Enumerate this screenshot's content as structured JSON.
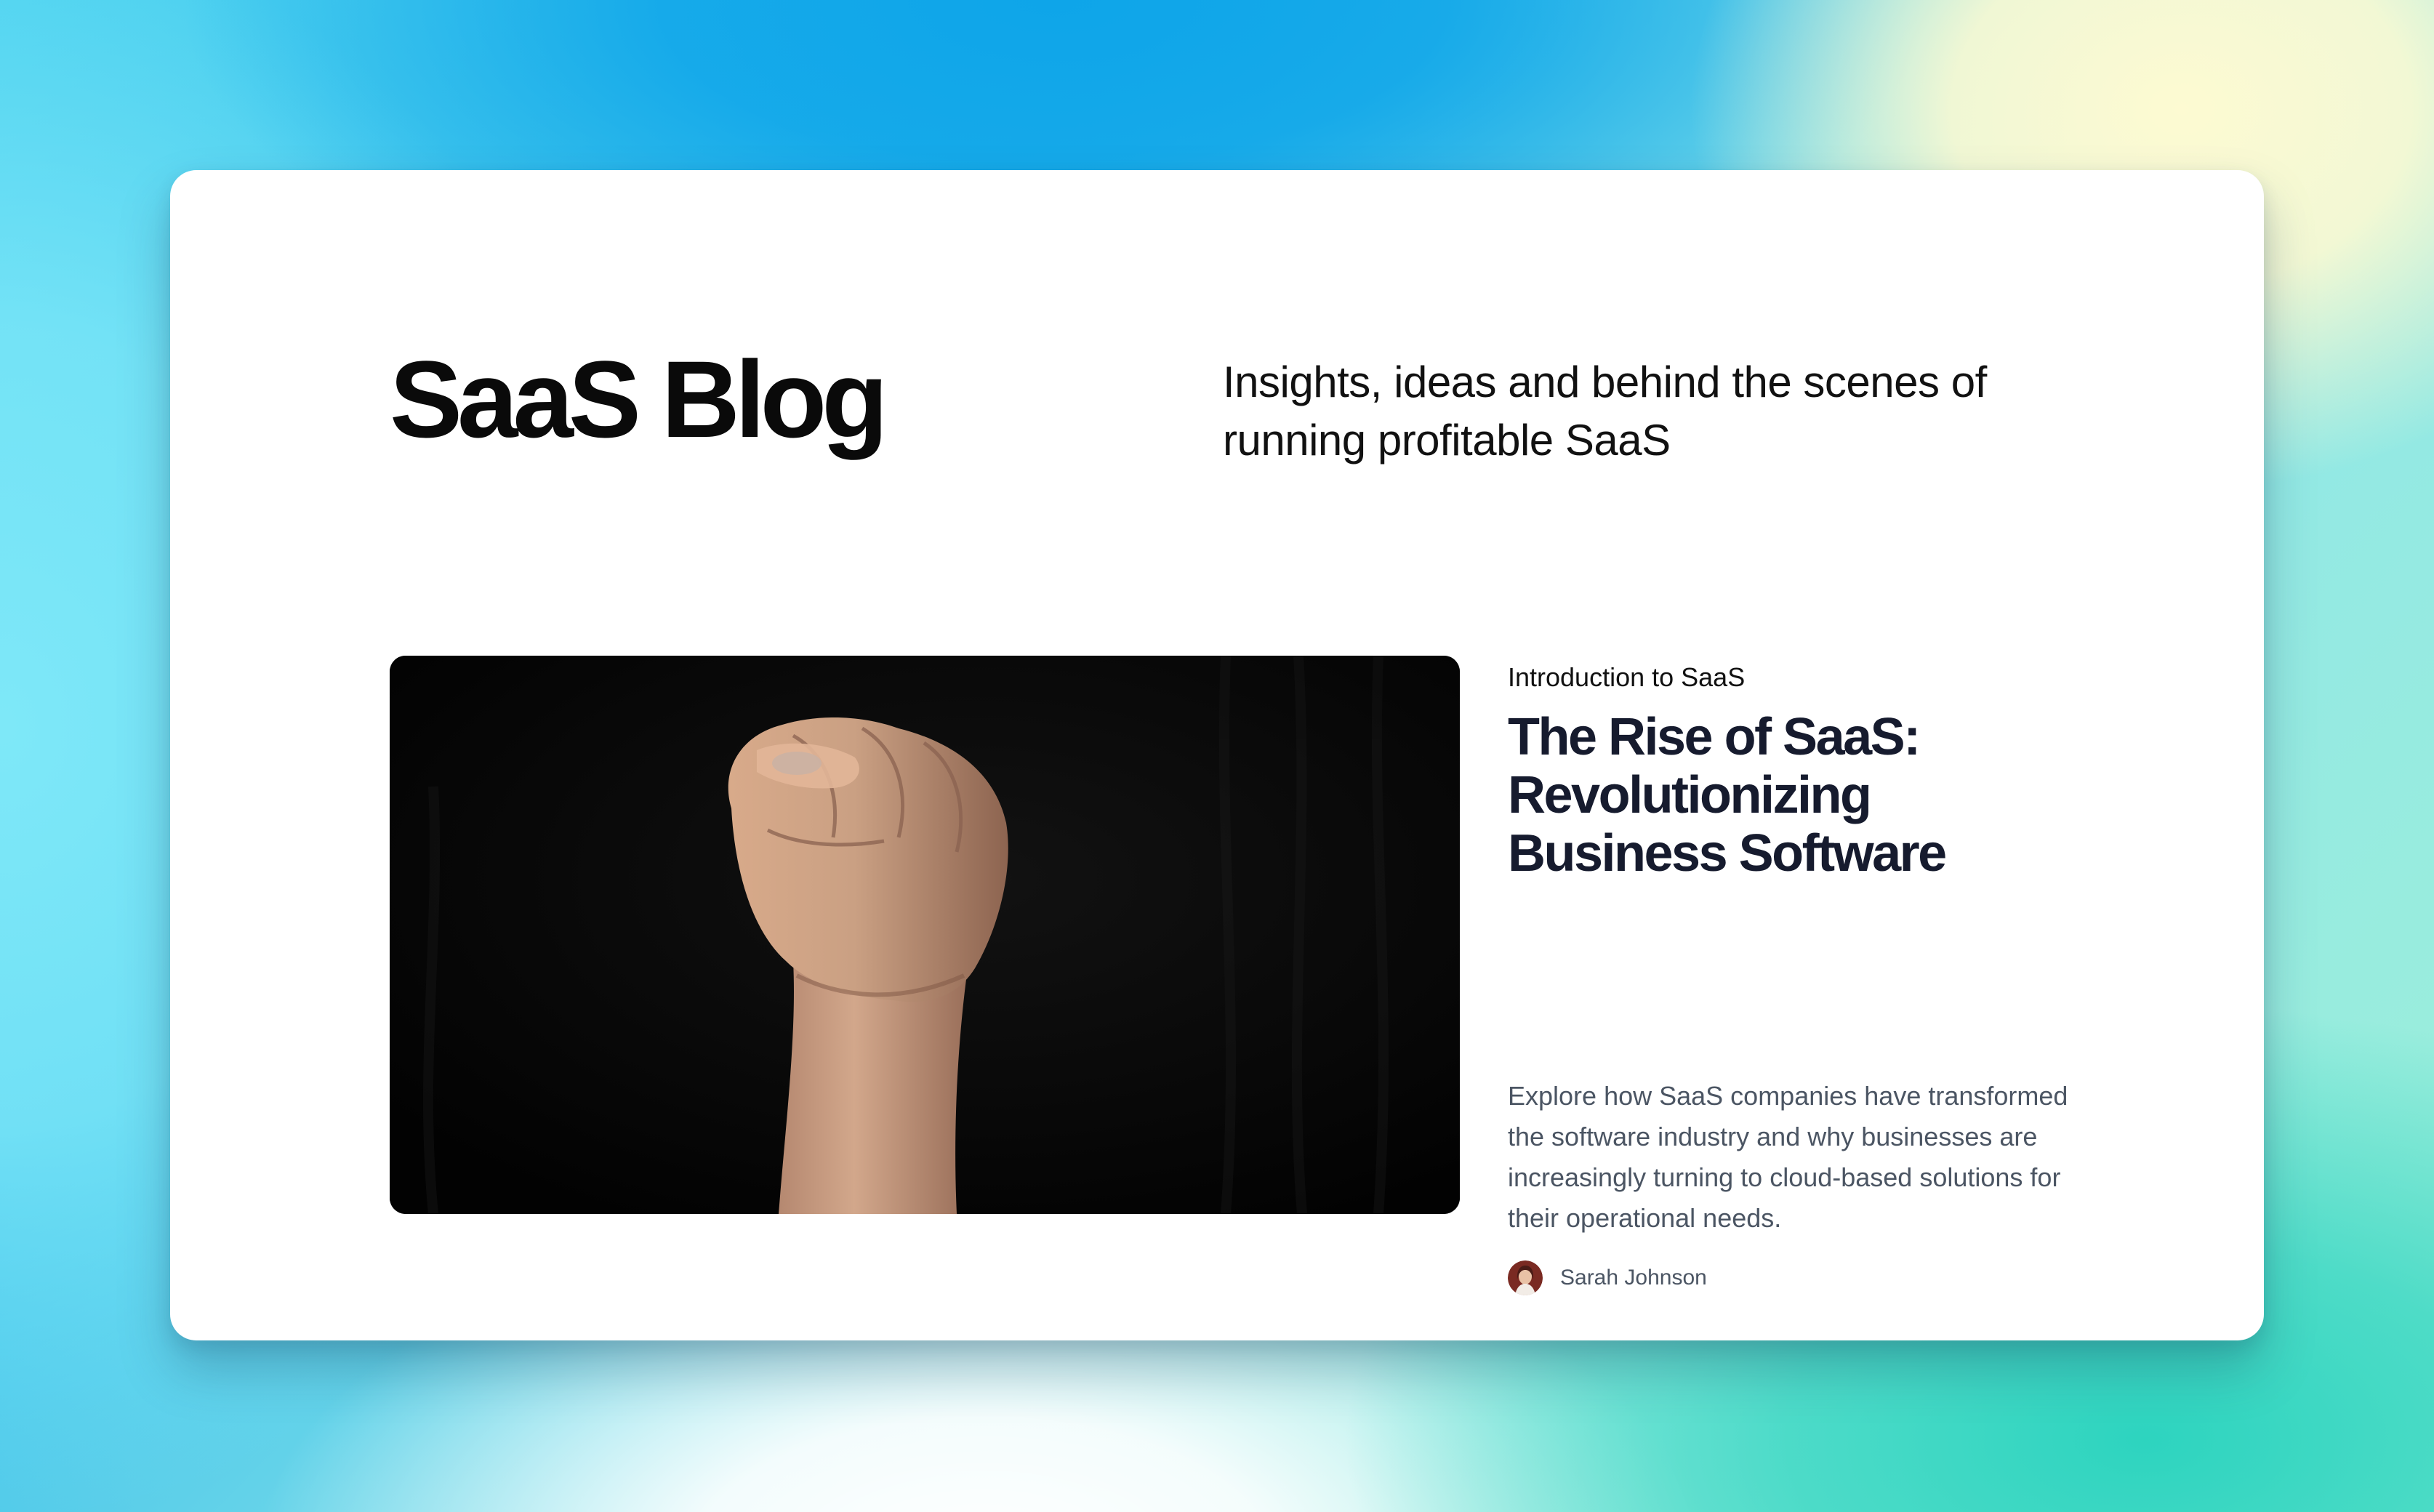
{
  "blog": {
    "title": "SaaS Blog",
    "tagline": "Insights, ideas and behind the scenes of running profitable SaaS"
  },
  "featured_post": {
    "category": "Introduction to SaaS",
    "title": "The Rise of SaaS: Revolutionizing Business Software",
    "excerpt": "Explore how SaaS companies have transformed the software industry and why businesses are increasingly turning to cloud-based solutions for their operational needs.",
    "author": "Sarah Johnson",
    "image_icon": "raised-fist-photo",
    "avatar_icon": "author-avatar"
  },
  "colors": {
    "title_text": "#0a0a0a",
    "post_title": "#161b2e",
    "body_text": "#4b5563",
    "card_background": "#ffffff",
    "background_blue": "#0ea5e9",
    "background_teal": "#2dd4bf",
    "background_cream": "#fdfad2"
  }
}
